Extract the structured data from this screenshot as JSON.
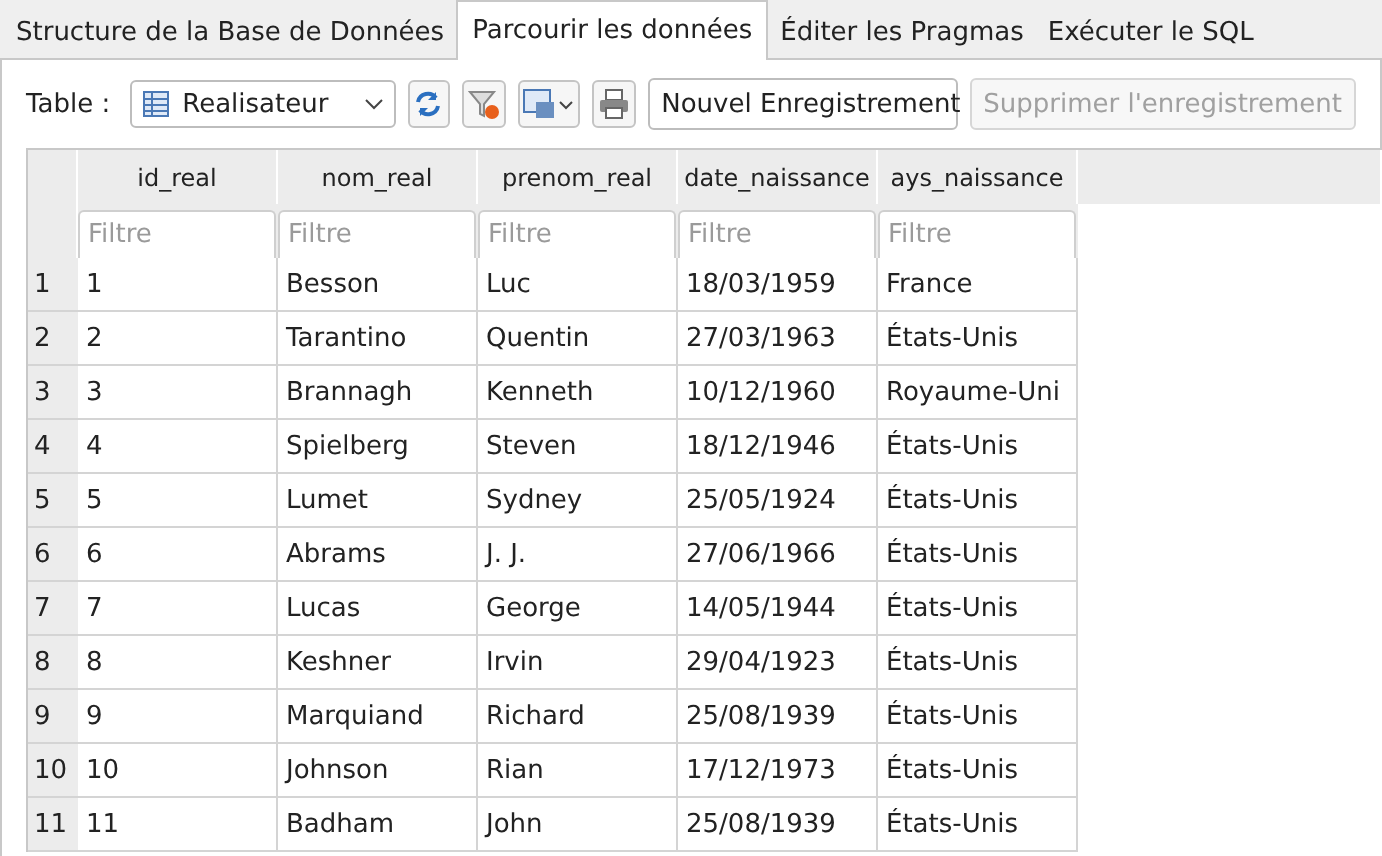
{
  "tabs": [
    {
      "label": "Structure de la Base de Données",
      "selected": false
    },
    {
      "label": "Parcourir les données",
      "selected": true
    },
    {
      "label": "Éditer les Pragmas",
      "selected": false
    },
    {
      "label": "Exécuter le SQL",
      "selected": false
    }
  ],
  "toolbar": {
    "table_label": "Table :",
    "table_value": "Realisateur",
    "new_record": "Nouvel Enregistrement",
    "delete_record": {
      "label": "Supprimer l'enregistrement",
      "disabled": true
    }
  },
  "table": {
    "columns": [
      "id_real",
      "nom_real",
      "prenom_real",
      "date_naissance",
      "ays_naissance"
    ],
    "filters": [
      {
        "placeholder": "Filtre"
      },
      {
        "placeholder": "Filtre"
      },
      {
        "placeholder": "Filtre"
      },
      {
        "placeholder": "Filtre"
      },
      {
        "placeholder": "Filtre"
      }
    ],
    "rows": [
      {
        "number": "1",
        "cells": [
          "1",
          "Besson",
          "Luc",
          "18/03/1959",
          "France"
        ]
      },
      {
        "number": "2",
        "cells": [
          "2",
          "Tarantino",
          "Quentin",
          "27/03/1963",
          "États-Unis"
        ]
      },
      {
        "number": "3",
        "cells": [
          "3",
          "Brannagh",
          "Kenneth",
          "10/12/1960",
          "Royaume-Uni"
        ]
      },
      {
        "number": "4",
        "cells": [
          "4",
          "Spielberg",
          "Steven",
          "18/12/1946",
          "États-Unis"
        ]
      },
      {
        "number": "5",
        "cells": [
          "5",
          "Lumet",
          "Sydney",
          "25/05/1924",
          "États-Unis"
        ]
      },
      {
        "number": "6",
        "cells": [
          "6",
          "Abrams",
          "J. J.",
          "27/06/1966",
          "États-Unis"
        ]
      },
      {
        "number": "7",
        "cells": [
          "7",
          "Lucas",
          "George",
          "14/05/1944",
          "États-Unis"
        ]
      },
      {
        "number": "8",
        "cells": [
          "8",
          "Keshner",
          "Irvin",
          "29/04/1923",
          "États-Unis"
        ]
      },
      {
        "number": "9",
        "cells": [
          "9",
          "Marquiand",
          "Richard",
          "25/08/1939",
          "États-Unis"
        ]
      },
      {
        "number": "10",
        "cells": [
          "10",
          "Johnson",
          "Rian",
          "17/12/1973",
          "États-Unis"
        ]
      },
      {
        "number": "11",
        "cells": [
          "11",
          "Badham",
          "John",
          "25/08/1939",
          "États-Unis"
        ]
      }
    ]
  }
}
